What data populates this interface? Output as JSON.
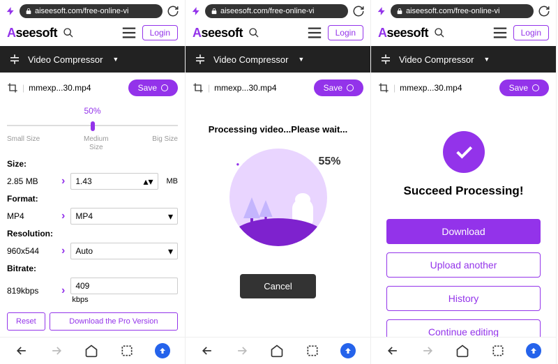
{
  "url": "aiseesoft.com/free-online-vi",
  "logo": "seesoft",
  "login": "Login",
  "tool": {
    "name": "Video Compressor"
  },
  "file": {
    "name": "mmexp...30.mp4",
    "save": "Save"
  },
  "s1": {
    "percent": "50%",
    "ticks": {
      "small": "Small Size",
      "medium": "Medium Size",
      "big": "Big Size"
    },
    "size": {
      "label": "Size:",
      "orig": "2.85 MB",
      "target": "1.43",
      "unit": "MB"
    },
    "format": {
      "label": "Format:",
      "orig": "MP4",
      "target": "MP4"
    },
    "resolution": {
      "label": "Resolution:",
      "orig": "960x544",
      "target": "Auto"
    },
    "bitrate": {
      "label": "Bitrate:",
      "orig": "819kbps",
      "target": "409",
      "unit": "kbps"
    },
    "reset": "Reset",
    "pro": "Download the Pro Version"
  },
  "s2": {
    "title": "Processing video...Please wait...",
    "percent": "55%",
    "cancel": "Cancel"
  },
  "s3": {
    "title": "Succeed Processing!",
    "download": "Download",
    "upload": "Upload another",
    "history": "History",
    "continue": "Continue editing"
  }
}
